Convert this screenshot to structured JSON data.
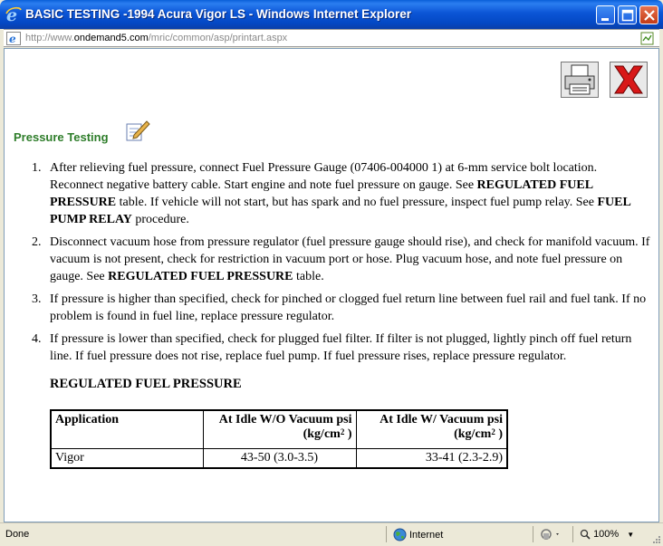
{
  "window": {
    "title": "BASIC TESTING -1994 Acura Vigor LS - Windows Internet Explorer",
    "url_prefix": "http://www.",
    "url_domain": "ondemand5.com",
    "url_path": "/mric/common/asp/printart.aspx"
  },
  "page": {
    "section_title": "Pressure Testing",
    "steps": [
      {
        "num": "1.",
        "parts": [
          {
            "t": "After relieving fuel pressure, connect Fuel Pressure Gauge (07406-004000 1) at 6-mm service bolt location. Reconnect negative battery cable. Start engine and note fuel pressure on gauge. See "
          },
          {
            "t": "REGULATED FUEL PRESSURE",
            "b": true
          },
          {
            "t": " table. If vehicle will not start, but has spark and no fuel pressure, inspect fuel pump relay. See "
          },
          {
            "t": "FUEL PUMP RELAY",
            "b": true
          },
          {
            "t": " procedure."
          }
        ]
      },
      {
        "num": "2.",
        "parts": [
          {
            "t": "Disconnect vacuum hose from pressure regulator (fuel pressure gauge should rise), and check for manifold vacuum. If vacuum is not present, check for restriction in vacuum port or hose. Plug vacuum hose, and note fuel pressure on gauge. See "
          },
          {
            "t": "REGULATED FUEL PRESSURE",
            "b": true
          },
          {
            "t": " table."
          }
        ]
      },
      {
        "num": "3.",
        "parts": [
          {
            "t": "If pressure is higher than specified, check for pinched or clogged fuel return line between fuel rail and fuel tank. If no problem is found in fuel line, replace pressure regulator."
          }
        ]
      },
      {
        "num": "4.",
        "parts": [
          {
            "t": "If pressure is lower than specified, check for plugged fuel filter. If filter is not plugged, lightly pinch off fuel return line. If fuel pressure does not rise, replace fuel pump. If fuel pressure rises, replace pressure regulator."
          }
        ]
      }
    ],
    "table": {
      "title": "REGULATED FUEL PRESSURE",
      "headers": {
        "application": "Application",
        "idle_wo_vacuum_line1": "At Idle W/O Vacuum psi",
        "idle_wo_vacuum_line2_pre": "(kg/cm",
        "idle_wo_vacuum_sup": "2",
        "idle_wo_vacuum_line2_post": " )",
        "idle_w_vacuum_line1": "At Idle W/ Vacuum psi",
        "idle_w_vacuum_line2_pre": "(kg/cm",
        "idle_w_vacuum_sup": "2",
        "idle_w_vacuum_line2_post": " )"
      },
      "rows": [
        {
          "application": "Vigor",
          "idle_wo_vacuum": "43-50 (3.0-3.5)",
          "idle_w_vacuum": "33-41 (2.3-2.9)"
        }
      ]
    }
  },
  "statusbar": {
    "status": "Done",
    "zone": "Internet",
    "zoom": "100%"
  },
  "icons": {
    "ie": "ie-logo-icon",
    "print": "printer-icon",
    "close": "red-x-close-icon",
    "note": "notepad-pencil-icon",
    "globe": "globe-icon"
  }
}
